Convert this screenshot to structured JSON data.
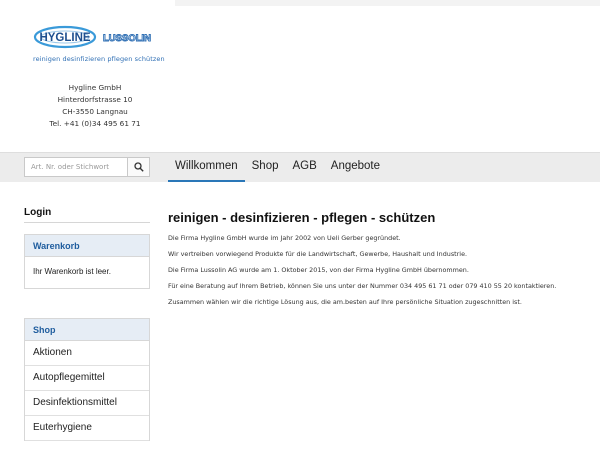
{
  "brand": {
    "logo_text_1": "HYGLINE",
    "logo_text_2": "LUSSOLIN",
    "tagline": "reinigen desinfizieren   pflegen schützen",
    "primary_color": "#2f6fb4",
    "accent_color": "#3a9ad9"
  },
  "address": {
    "company": "Hygline GmbH",
    "street": "Hinterdorfstrasse 10",
    "city": "CH-3550 Langnau",
    "phone": "Tel. +41 (0)34 495 61 71"
  },
  "search": {
    "placeholder": "Art. Nr. oder Stichwort",
    "icon": "search-icon"
  },
  "nav": {
    "items": [
      {
        "label": "Willkommen",
        "active": true
      },
      {
        "label": "Shop"
      },
      {
        "label": "AGB"
      },
      {
        "label": "Angebote"
      }
    ]
  },
  "sidebar": {
    "login_label": "Login",
    "cart": {
      "title": "Warenkorb",
      "empty_text": "Ihr Warenkorb ist leer."
    },
    "shop": {
      "title": "Shop",
      "items": [
        {
          "label": "Aktionen"
        },
        {
          "label": "Autopflegemittel"
        },
        {
          "label": "Desinfektionsmittel"
        },
        {
          "label": "Euterhygiene"
        }
      ]
    }
  },
  "main": {
    "heading": "reinigen - desinfizieren - pflegen - schützen",
    "paragraphs": [
      "Die Firma Hygline GmbH wurde im Jahr 2002 von Ueli Gerber gegründet.",
      "Wir vertreiben vorwiegend Produkte für die Landwirtschaft, Gewerbe, Haushalt und Industrie.",
      "Die Firma Lussolin AG wurde am 1. Oktober 2015, von der Firma Hygline GmbH übernommen.",
      "Für eine Beratung auf Ihrem Betrieb, können Sie uns unter der Nummer 034 495 61 71 oder 079 410 55 20 kontaktieren.",
      "Zusammen wählen wir die richtige Lösung aus, die am.besten auf Ihre persönliche Situation zugeschnitten ist."
    ]
  }
}
